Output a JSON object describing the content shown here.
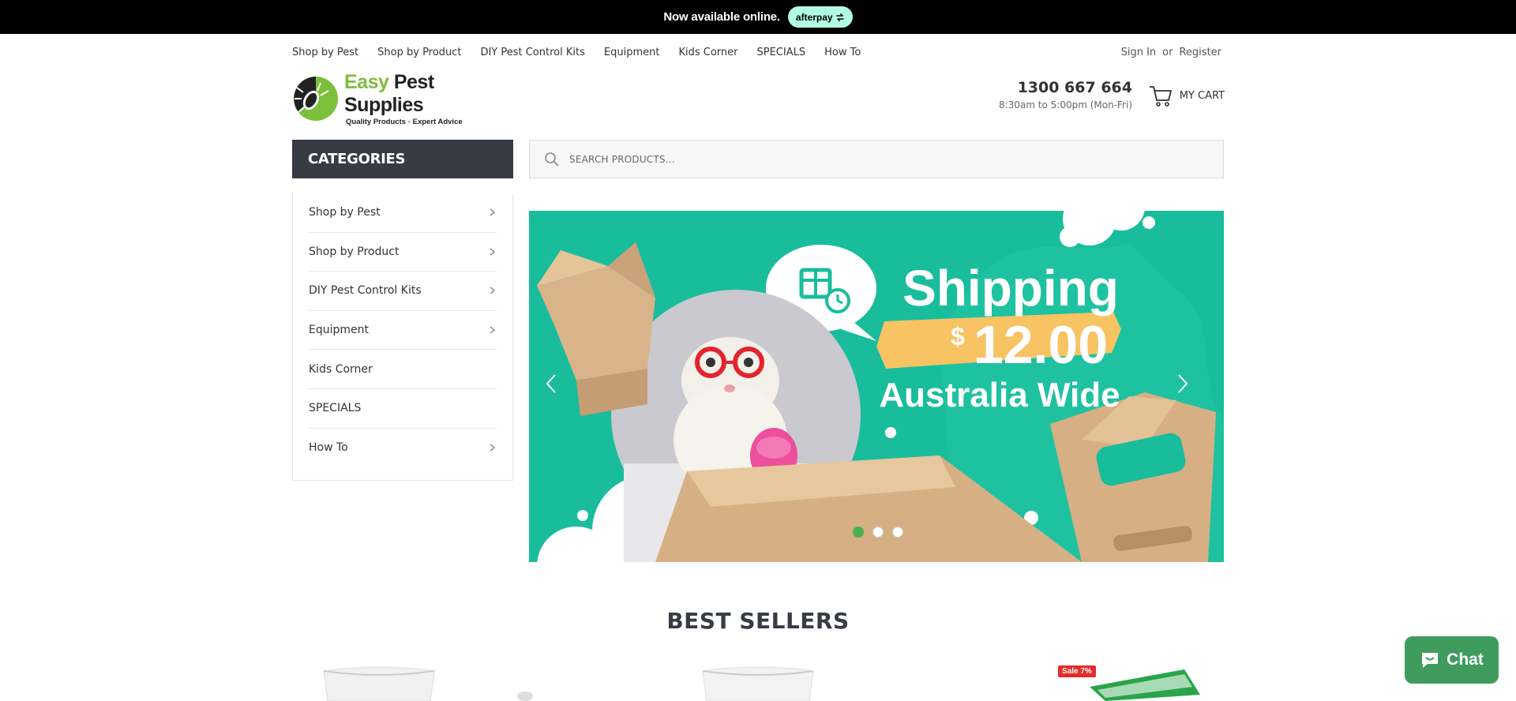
{
  "announcement": {
    "text": "Now available online.",
    "badge": "afterpay"
  },
  "nav": {
    "items": [
      "Shop by Pest",
      "Shop by Product",
      "DIY Pest Control Kits",
      "Equipment",
      "Kids Corner",
      "SPECIALS",
      "How To"
    ]
  },
  "account": {
    "sign_in": "Sign In",
    "or": "or",
    "register": "Register"
  },
  "logo": {
    "name_part1": "Easy",
    "name_part2": "Pest Supplies",
    "tagline_part1": "Quality Products",
    "tagline_sep": "•",
    "tagline_part2": "Expert Advice"
  },
  "contact": {
    "phone": "1300 667 664",
    "hours": "8:30am to 5:00pm (Mon-Fri)"
  },
  "cart": {
    "label": "MY CART"
  },
  "categories": {
    "title": "CATEGORIES",
    "items": [
      {
        "label": "Shop by Pest",
        "has_children": true
      },
      {
        "label": "Shop by Product",
        "has_children": true
      },
      {
        "label": "DIY Pest Control Kits",
        "has_children": true
      },
      {
        "label": "Equipment",
        "has_children": true
      },
      {
        "label": "Kids Corner",
        "has_children": false
      },
      {
        "label": "SPECIALS",
        "has_children": false
      },
      {
        "label": "How To",
        "has_children": true
      }
    ]
  },
  "search": {
    "placeholder": "SEARCH PRODUCTS..."
  },
  "banner": {
    "headline": "Shipping",
    "currency": "$",
    "price": "12.00",
    "subline": "Australia Wide",
    "slide_count": 3,
    "active_slide": 1
  },
  "best_sellers": {
    "title": "BEST SELLERS",
    "sale_badge": "Sale 7%"
  },
  "chat": {
    "label": "Chat"
  },
  "colors": {
    "banner_bg": "#19bd9c",
    "category_header": "#363b44",
    "brand_green": "#7cbf3a",
    "price_highlight": "#f7c363",
    "chat_button": "#3f9b5e"
  }
}
